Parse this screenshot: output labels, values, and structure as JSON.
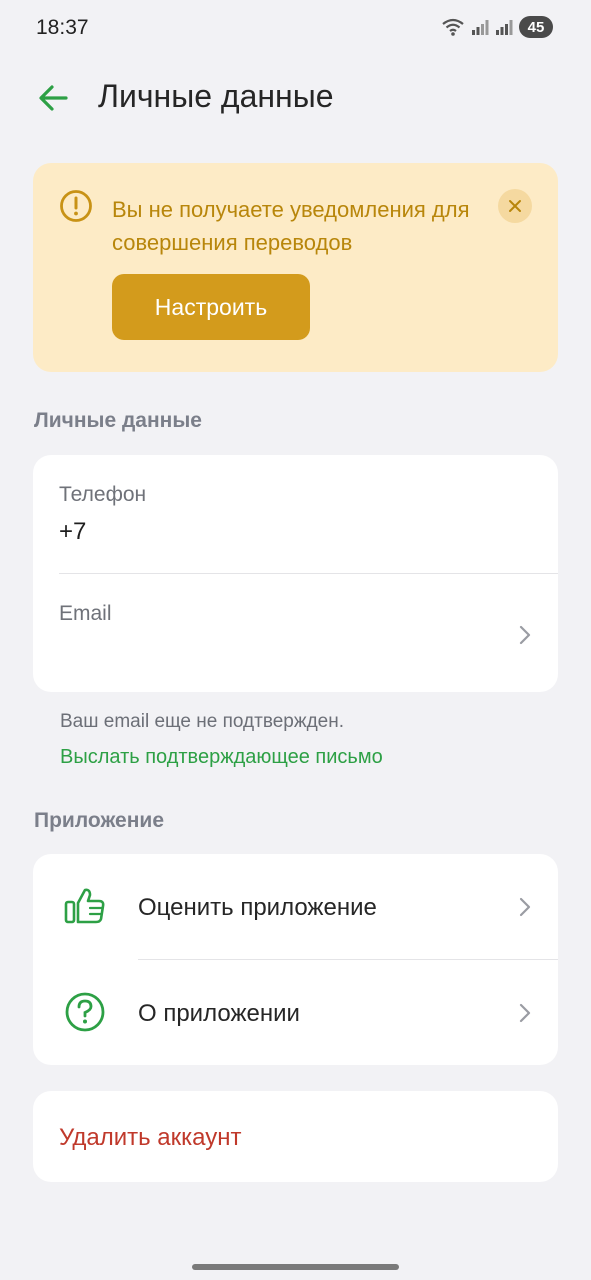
{
  "status_bar": {
    "time": "18:37",
    "battery": "45"
  },
  "header": {
    "title": "Личные данные"
  },
  "banner": {
    "message": "Вы не получаете уведомления для совершения переводов",
    "button_label": "Настроить"
  },
  "personal": {
    "section_title": "Личные данные",
    "phone_label": "Телефон",
    "phone_value": "+7",
    "email_label": "Email",
    "email_note": "Ваш email еще не подтвержден.",
    "resend_link": "Выслать подтверждающее письмо"
  },
  "app_section": {
    "section_title": "Приложение",
    "items": [
      {
        "label": "Оценить приложение",
        "icon": "thumbs-up-icon"
      },
      {
        "label": "О приложении",
        "icon": "question-circle-icon"
      }
    ]
  },
  "danger": {
    "delete_label": "Удалить аккаунт"
  },
  "colors": {
    "accent_green": "#2da045",
    "warning_bg": "#fdebc6",
    "warning_text": "#b8860b",
    "warning_button": "#d39b1c",
    "danger_red": "#c0392b"
  }
}
